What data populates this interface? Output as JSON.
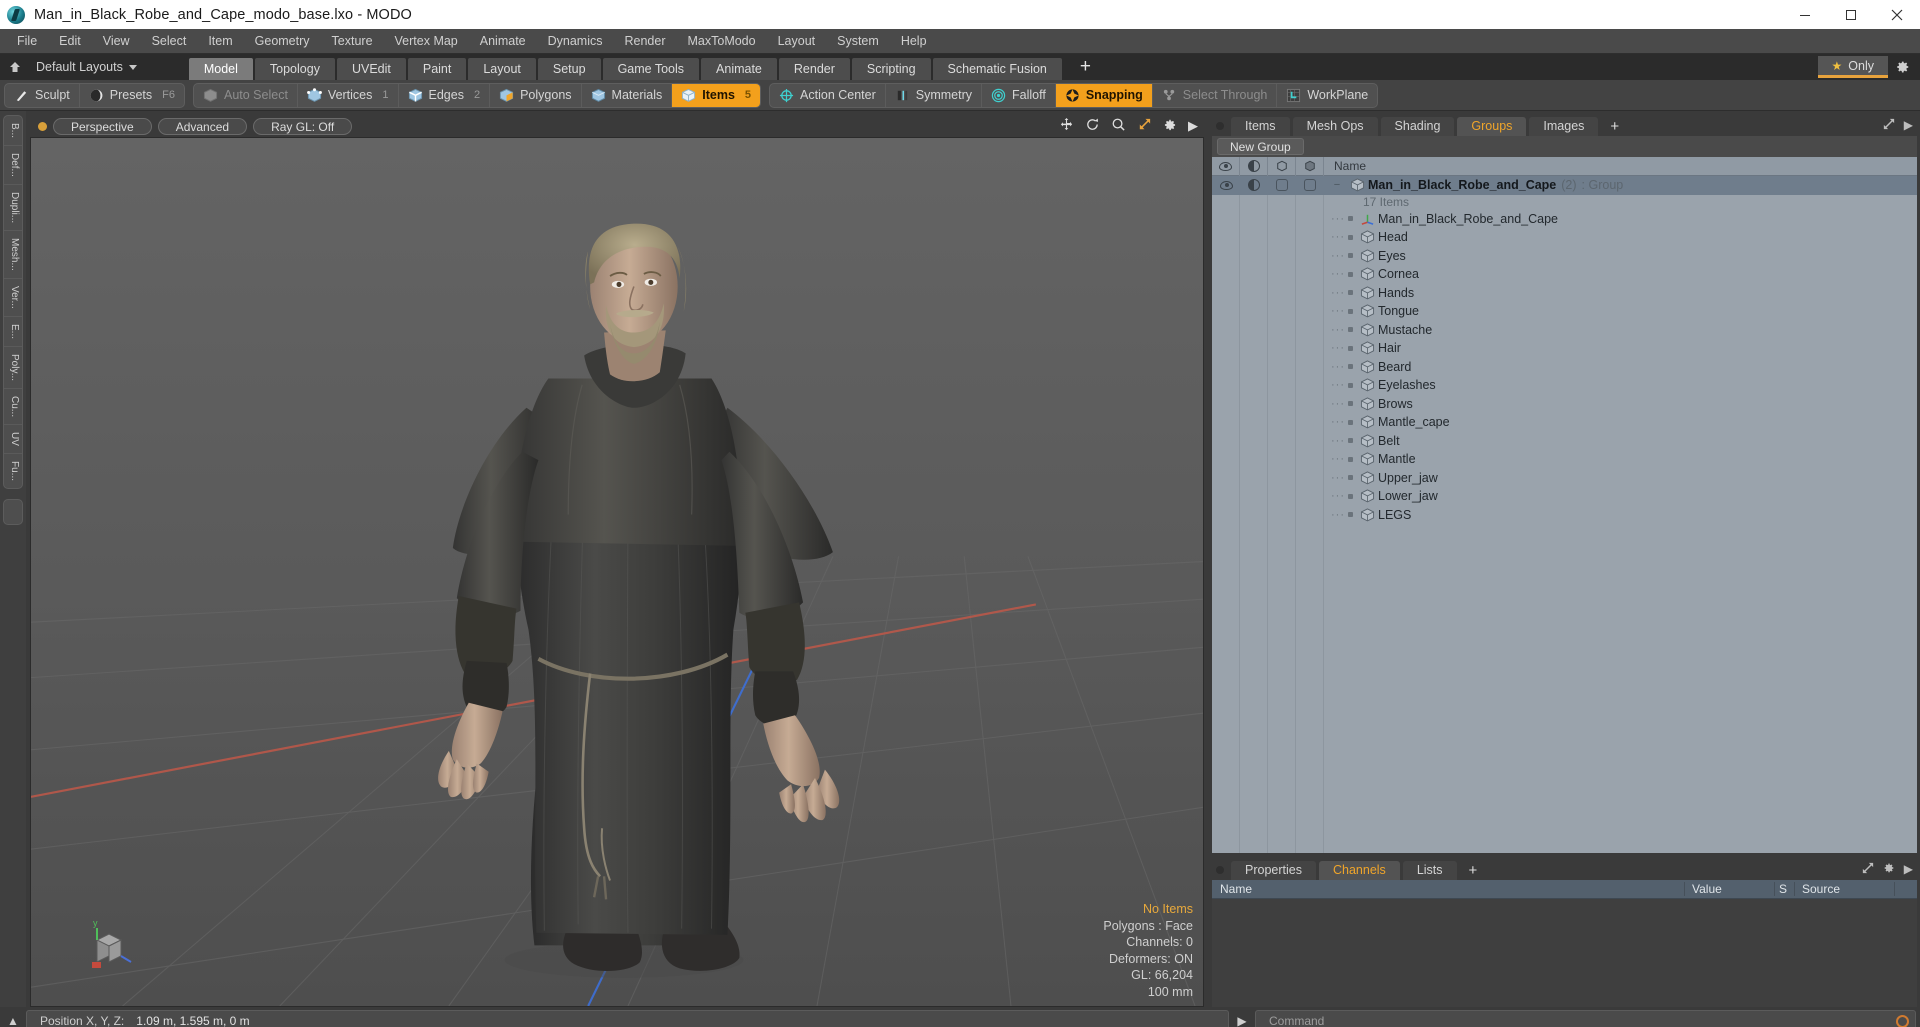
{
  "window": {
    "title": "Man_in_Black_Robe_and_Cape_modo_base.lxo - MODO",
    "app_icon": "modo-logo-icon",
    "minimize": "–",
    "maximize": "☐",
    "close": "✕"
  },
  "menu": {
    "items": [
      "File",
      "Edit",
      "View",
      "Select",
      "Item",
      "Geometry",
      "Texture",
      "Vertex Map",
      "Animate",
      "Dynamics",
      "Render",
      "MaxToModo",
      "Layout",
      "System",
      "Help"
    ]
  },
  "layout_bar": {
    "home_icon": "home-up-icon",
    "default_layouts": "Default Layouts",
    "tabs": [
      {
        "label": "Model",
        "active": true
      },
      {
        "label": "Topology",
        "active": false
      },
      {
        "label": "UVEdit",
        "active": false
      },
      {
        "label": "Paint",
        "active": false
      },
      {
        "label": "Layout",
        "active": false
      },
      {
        "label": "Setup",
        "active": false
      },
      {
        "label": "Game Tools",
        "active": false
      },
      {
        "label": "Animate",
        "active": false
      },
      {
        "label": "Render",
        "active": false
      },
      {
        "label": "Scripting",
        "active": false
      },
      {
        "label": "Schematic Fusion",
        "active": false
      }
    ],
    "add_tab": "+",
    "only_label": "Only",
    "star_icon": "star-icon",
    "gear_icon": "gear-icon",
    "accent": "#e8a33d"
  },
  "mode_toolbar": {
    "groups": [
      {
        "tools": [
          {
            "label": "Sculpt",
            "icon": "brush-icon",
            "state": "normal",
            "key": ""
          },
          {
            "label": "Presets",
            "icon": "sphere-icon",
            "state": "normal",
            "key": "F6"
          }
        ]
      },
      {
        "tools": [
          {
            "label": "Auto Select",
            "icon": "cube-grey-icon",
            "state": "disabled",
            "key": ""
          },
          {
            "label": "Vertices",
            "icon": "cube-vertex-icon",
            "state": "normal",
            "key": "1"
          },
          {
            "label": "Edges",
            "icon": "cube-edge-icon",
            "state": "normal",
            "key": "2"
          },
          {
            "label": "Polygons",
            "icon": "cube-poly-icon",
            "state": "normal",
            "key": ""
          },
          {
            "label": "Materials",
            "icon": "cube-material-icon",
            "state": "normal",
            "key": ""
          },
          {
            "label": "Items",
            "icon": "cube-items-icon",
            "state": "active",
            "key": "5"
          }
        ]
      },
      {
        "tools": [
          {
            "label": "Action Center",
            "icon": "crosshair-icon",
            "state": "normal",
            "key": ""
          },
          {
            "label": "Symmetry",
            "icon": "symmetry-icon",
            "state": "normal",
            "key": ""
          },
          {
            "label": "Falloff",
            "icon": "falloff-icon",
            "state": "normal",
            "key": ""
          },
          {
            "label": "Snapping",
            "icon": "snapping-icon",
            "state": "active",
            "key": ""
          },
          {
            "label": "Select Through",
            "icon": "select-through-icon",
            "state": "disabled",
            "key": ""
          },
          {
            "label": "WorkPlane",
            "icon": "workplane-icon",
            "state": "normal",
            "key": ""
          }
        ]
      }
    ]
  },
  "left_rail": {
    "tabs": [
      "B...",
      "Def...",
      "Dupli...",
      "Mesh...",
      "Ver...",
      "E...",
      "Poly...",
      "Cu...",
      "UV",
      "Fu..."
    ]
  },
  "viewport": {
    "indicator_color": "#d8a03a",
    "buttons": [
      "Perspective",
      "Advanced",
      "Ray GL: Off"
    ],
    "nav_icons": [
      "move-icon",
      "rotate-icon",
      "zoom-icon",
      "fit-icon",
      "gear-icon",
      "chevron-right-icon"
    ],
    "stats": {
      "selection": "No Items",
      "mode": "Polygons : Face",
      "channels": "Channels: 0",
      "deformers": "Deformers: ON",
      "gl": "GL: 66,204",
      "grid": "100 mm"
    },
    "gizmo": {
      "x": "x",
      "y": "y",
      "z": "z"
    }
  },
  "right_panel": {
    "tabs": [
      {
        "label": "Items",
        "active": false
      },
      {
        "label": "Mesh Ops",
        "active": false
      },
      {
        "label": "Shading",
        "active": false
      },
      {
        "label": "Groups",
        "active": true
      },
      {
        "label": "Images",
        "active": false
      }
    ],
    "add_tab": "+",
    "new_group_button": "New Group",
    "column_headers": {
      "visible_icon": "eye-icon",
      "shade_icon": "half-circle-icon",
      "lock_icon": "cube-outline-icon",
      "render_icon": "cube-solid-icon",
      "name": "Name"
    },
    "group": {
      "name": "Man_in_Black_Robe_and_Cape",
      "count": "(2)",
      "type": ": Group",
      "sub_label": "17 Items",
      "icon": "cube-icon"
    },
    "items": [
      {
        "label": "Man_in_Black_Robe_and_Cape",
        "icon": "locator-axis-icon"
      },
      {
        "label": "Head",
        "icon": "cube-icon"
      },
      {
        "label": "Eyes",
        "icon": "cube-icon"
      },
      {
        "label": "Cornea",
        "icon": "cube-icon"
      },
      {
        "label": "Hands",
        "icon": "cube-icon"
      },
      {
        "label": "Tongue",
        "icon": "cube-icon"
      },
      {
        "label": "Mustache",
        "icon": "cube-icon"
      },
      {
        "label": "Hair",
        "icon": "cube-icon"
      },
      {
        "label": "Beard",
        "icon": "cube-icon"
      },
      {
        "label": "Eyelashes",
        "icon": "cube-icon"
      },
      {
        "label": "Brows",
        "icon": "cube-icon"
      },
      {
        "label": "Mantle_cape",
        "icon": "cube-icon"
      },
      {
        "label": "Belt",
        "icon": "cube-icon"
      },
      {
        "label": "Mantle",
        "icon": "cube-icon"
      },
      {
        "label": "Upper_jaw",
        "icon": "cube-icon"
      },
      {
        "label": "Lower_jaw",
        "icon": "cube-icon"
      },
      {
        "label": "LEGS",
        "icon": "cube-icon"
      }
    ]
  },
  "bottom_dock": {
    "tabs": [
      {
        "label": "Properties",
        "active": false
      },
      {
        "label": "Channels",
        "active": true
      },
      {
        "label": "Lists",
        "active": false
      }
    ],
    "add_tab": "+",
    "columns": [
      "Name",
      "Value",
      "S",
      "Source"
    ]
  },
  "status_bar": {
    "position_label": "Position X, Y, Z:",
    "position_value": "1.09 m, 1.595 m, 0 m",
    "command_placeholder": "Command",
    "record_icon": "record-icon"
  }
}
